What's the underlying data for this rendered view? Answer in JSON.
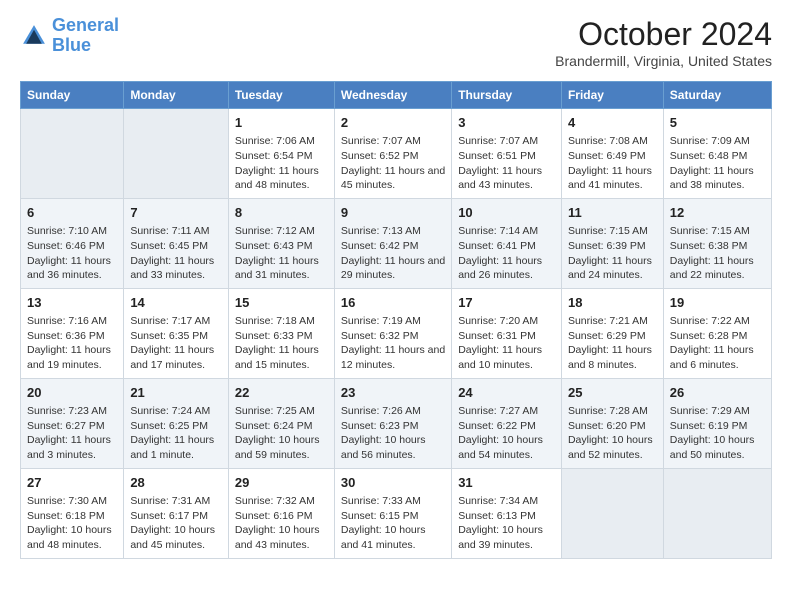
{
  "app": {
    "logo_line1": "General",
    "logo_line2": "Blue"
  },
  "header": {
    "title": "October 2024",
    "subtitle": "Brandermill, Virginia, United States"
  },
  "days_of_week": [
    "Sunday",
    "Monday",
    "Tuesday",
    "Wednesday",
    "Thursday",
    "Friday",
    "Saturday"
  ],
  "weeks": [
    [
      {
        "day": "",
        "sunrise": "",
        "sunset": "",
        "daylight": ""
      },
      {
        "day": "",
        "sunrise": "",
        "sunset": "",
        "daylight": ""
      },
      {
        "day": "1",
        "sunrise": "Sunrise: 7:06 AM",
        "sunset": "Sunset: 6:54 PM",
        "daylight": "Daylight: 11 hours and 48 minutes."
      },
      {
        "day": "2",
        "sunrise": "Sunrise: 7:07 AM",
        "sunset": "Sunset: 6:52 PM",
        "daylight": "Daylight: 11 hours and 45 minutes."
      },
      {
        "day": "3",
        "sunrise": "Sunrise: 7:07 AM",
        "sunset": "Sunset: 6:51 PM",
        "daylight": "Daylight: 11 hours and 43 minutes."
      },
      {
        "day": "4",
        "sunrise": "Sunrise: 7:08 AM",
        "sunset": "Sunset: 6:49 PM",
        "daylight": "Daylight: 11 hours and 41 minutes."
      },
      {
        "day": "5",
        "sunrise": "Sunrise: 7:09 AM",
        "sunset": "Sunset: 6:48 PM",
        "daylight": "Daylight: 11 hours and 38 minutes."
      }
    ],
    [
      {
        "day": "6",
        "sunrise": "Sunrise: 7:10 AM",
        "sunset": "Sunset: 6:46 PM",
        "daylight": "Daylight: 11 hours and 36 minutes."
      },
      {
        "day": "7",
        "sunrise": "Sunrise: 7:11 AM",
        "sunset": "Sunset: 6:45 PM",
        "daylight": "Daylight: 11 hours and 33 minutes."
      },
      {
        "day": "8",
        "sunrise": "Sunrise: 7:12 AM",
        "sunset": "Sunset: 6:43 PM",
        "daylight": "Daylight: 11 hours and 31 minutes."
      },
      {
        "day": "9",
        "sunrise": "Sunrise: 7:13 AM",
        "sunset": "Sunset: 6:42 PM",
        "daylight": "Daylight: 11 hours and 29 minutes."
      },
      {
        "day": "10",
        "sunrise": "Sunrise: 7:14 AM",
        "sunset": "Sunset: 6:41 PM",
        "daylight": "Daylight: 11 hours and 26 minutes."
      },
      {
        "day": "11",
        "sunrise": "Sunrise: 7:15 AM",
        "sunset": "Sunset: 6:39 PM",
        "daylight": "Daylight: 11 hours and 24 minutes."
      },
      {
        "day": "12",
        "sunrise": "Sunrise: 7:15 AM",
        "sunset": "Sunset: 6:38 PM",
        "daylight": "Daylight: 11 hours and 22 minutes."
      }
    ],
    [
      {
        "day": "13",
        "sunrise": "Sunrise: 7:16 AM",
        "sunset": "Sunset: 6:36 PM",
        "daylight": "Daylight: 11 hours and 19 minutes."
      },
      {
        "day": "14",
        "sunrise": "Sunrise: 7:17 AM",
        "sunset": "Sunset: 6:35 PM",
        "daylight": "Daylight: 11 hours and 17 minutes."
      },
      {
        "day": "15",
        "sunrise": "Sunrise: 7:18 AM",
        "sunset": "Sunset: 6:33 PM",
        "daylight": "Daylight: 11 hours and 15 minutes."
      },
      {
        "day": "16",
        "sunrise": "Sunrise: 7:19 AM",
        "sunset": "Sunset: 6:32 PM",
        "daylight": "Daylight: 11 hours and 12 minutes."
      },
      {
        "day": "17",
        "sunrise": "Sunrise: 7:20 AM",
        "sunset": "Sunset: 6:31 PM",
        "daylight": "Daylight: 11 hours and 10 minutes."
      },
      {
        "day": "18",
        "sunrise": "Sunrise: 7:21 AM",
        "sunset": "Sunset: 6:29 PM",
        "daylight": "Daylight: 11 hours and 8 minutes."
      },
      {
        "day": "19",
        "sunrise": "Sunrise: 7:22 AM",
        "sunset": "Sunset: 6:28 PM",
        "daylight": "Daylight: 11 hours and 6 minutes."
      }
    ],
    [
      {
        "day": "20",
        "sunrise": "Sunrise: 7:23 AM",
        "sunset": "Sunset: 6:27 PM",
        "daylight": "Daylight: 11 hours and 3 minutes."
      },
      {
        "day": "21",
        "sunrise": "Sunrise: 7:24 AM",
        "sunset": "Sunset: 6:25 PM",
        "daylight": "Daylight: 11 hours and 1 minute."
      },
      {
        "day": "22",
        "sunrise": "Sunrise: 7:25 AM",
        "sunset": "Sunset: 6:24 PM",
        "daylight": "Daylight: 10 hours and 59 minutes."
      },
      {
        "day": "23",
        "sunrise": "Sunrise: 7:26 AM",
        "sunset": "Sunset: 6:23 PM",
        "daylight": "Daylight: 10 hours and 56 minutes."
      },
      {
        "day": "24",
        "sunrise": "Sunrise: 7:27 AM",
        "sunset": "Sunset: 6:22 PM",
        "daylight": "Daylight: 10 hours and 54 minutes."
      },
      {
        "day": "25",
        "sunrise": "Sunrise: 7:28 AM",
        "sunset": "Sunset: 6:20 PM",
        "daylight": "Daylight: 10 hours and 52 minutes."
      },
      {
        "day": "26",
        "sunrise": "Sunrise: 7:29 AM",
        "sunset": "Sunset: 6:19 PM",
        "daylight": "Daylight: 10 hours and 50 minutes."
      }
    ],
    [
      {
        "day": "27",
        "sunrise": "Sunrise: 7:30 AM",
        "sunset": "Sunset: 6:18 PM",
        "daylight": "Daylight: 10 hours and 48 minutes."
      },
      {
        "day": "28",
        "sunrise": "Sunrise: 7:31 AM",
        "sunset": "Sunset: 6:17 PM",
        "daylight": "Daylight: 10 hours and 45 minutes."
      },
      {
        "day": "29",
        "sunrise": "Sunrise: 7:32 AM",
        "sunset": "Sunset: 6:16 PM",
        "daylight": "Daylight: 10 hours and 43 minutes."
      },
      {
        "day": "30",
        "sunrise": "Sunrise: 7:33 AM",
        "sunset": "Sunset: 6:15 PM",
        "daylight": "Daylight: 10 hours and 41 minutes."
      },
      {
        "day": "31",
        "sunrise": "Sunrise: 7:34 AM",
        "sunset": "Sunset: 6:13 PM",
        "daylight": "Daylight: 10 hours and 39 minutes."
      },
      {
        "day": "",
        "sunrise": "",
        "sunset": "",
        "daylight": ""
      },
      {
        "day": "",
        "sunrise": "",
        "sunset": "",
        "daylight": ""
      }
    ]
  ]
}
